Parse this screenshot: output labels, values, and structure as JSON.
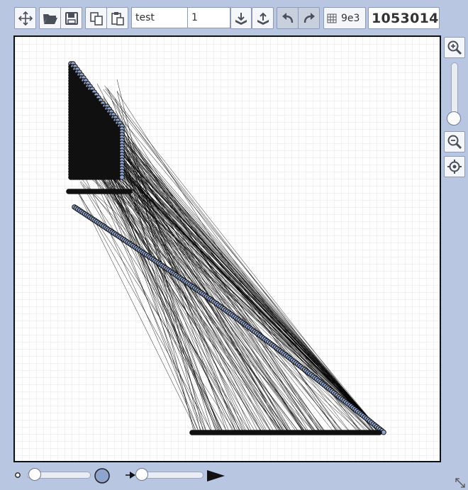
{
  "toolbar": {
    "move_icon": "move-arrows-icon",
    "open_icon": "folder-open-icon",
    "save_icon": "save-disk-icon",
    "copy_icon": "copy-icon",
    "paste_icon": "paste-icon",
    "name_value": "test",
    "index_value": "1",
    "import_icon": "tray-import-icon",
    "export_icon": "tray-export-icon",
    "undo_icon": "undo-icon",
    "redo_icon": "redo-icon",
    "grid_icon": "grid-icon",
    "grid_label": "9e3",
    "count_value": "1053014"
  },
  "side_controls": {
    "zoom_in_icon": "zoom-in-icon",
    "zoom_level": 1.0,
    "zoom_out_icon": "zoom-out-icon",
    "locate_icon": "crosshair-target-icon"
  },
  "bottom_controls": {
    "node_size_small_icon": "small-circle-icon",
    "node_size_level": 0.0,
    "node_size_large_icon": "large-circle-icon",
    "arrow_small_icon": "small-arrow-icon",
    "arrow_size_level": 0.0,
    "arrow_large_icon": "large-arrow-icon",
    "resize_icon": "resize-corner-icon"
  },
  "colors": {
    "background": "#b8c6e2",
    "node_fill": "#8fa3cf",
    "node_stroke": "#111111",
    "edge": "#000000",
    "grid": "#e4e4e4"
  }
}
